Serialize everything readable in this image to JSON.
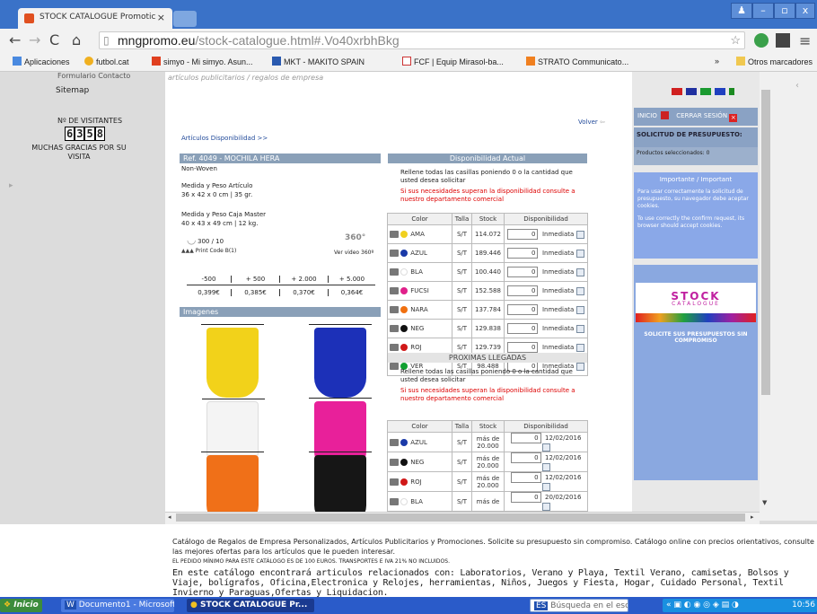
{
  "browser": {
    "tab_title": "STOCK CATALOGUE Promotic",
    "url_host": "mngpromo.eu",
    "url_path": "/stock-catalogue.html#.Vo40xrbhBkg"
  },
  "bookmarks": [
    "Aplicaciones",
    "futbol.cat",
    "simyo - Mi simyo. Asun...",
    "MKT - MAKITO SPAIN",
    "FCF | Equip Mirasol-ba...",
    "STRATO Communicato...",
    "»",
    "Otros marcadores"
  ],
  "left": {
    "contact": "Formulario Contacto",
    "sitemap": "Sitemap",
    "visitors_label": "Nº DE VISITANTES",
    "visitors": [
      "6",
      "3",
      "5",
      "8"
    ],
    "thanks": "MUCHAS GRACIAS POR SU VISITA"
  },
  "content": {
    "tagline": "artículos publicitarios / regalos de empresa",
    "breadcrumb": "Artículos Disponibilidad >>",
    "back": "Volver",
    "ref_bar": "Ref.   4049 - MOCHILA HERA",
    "material": "Non-Woven",
    "measure_label": "Medida y Peso Artículo",
    "measure": "36 x 42 x 0 cm  |  35 gr.",
    "box_label": "Medida y Peso Caja Master",
    "box": "40 x 43 x 49 cm  |  12 kg.",
    "pack": "300  / 10",
    "print": "Print Code B(1)",
    "video": "Ver video 360º",
    "rot": "360°",
    "price_headers": [
      "-500",
      "+ 500",
      "+ 2.000",
      "+ 5.000"
    ],
    "prices": [
      "0,399€",
      "0,385€",
      "0,370€",
      "0,364€"
    ],
    "images_bar": "Imagenes",
    "avail_bar": "Disponibilidad Actual",
    "note1": "Rellene todas las casillas poniendo 0 o la cantidad que usted desea solicitar",
    "note2": "Si sus necesidades superan la disponibilidad consulte a nuestro departamento comercial",
    "cols": [
      "Color",
      "Talla",
      "Stock",
      "Disponibilidad"
    ],
    "rows": [
      {
        "c": "AMA",
        "hex": "#f0d020",
        "t": "S/T",
        "s": "114.072",
        "q": "0",
        "d": "Inmediata"
      },
      {
        "c": "AZUL",
        "hex": "#1a3aa8",
        "t": "S/T",
        "s": "189.446",
        "q": "0",
        "d": "Inmediata"
      },
      {
        "c": "BLA",
        "hex": "#ffffff",
        "t": "S/T",
        "s": "100.440",
        "q": "0",
        "d": "Inmediata"
      },
      {
        "c": "FUCSI",
        "hex": "#e0208a",
        "t": "S/T",
        "s": "152.588",
        "q": "0",
        "d": "Inmediata"
      },
      {
        "c": "NARA",
        "hex": "#f07010",
        "t": "S/T",
        "s": "137.784",
        "q": "0",
        "d": "Inmediata"
      },
      {
        "c": "NEG",
        "hex": "#111111",
        "t": "S/T",
        "s": "129.838",
        "q": "0",
        "d": "Inmediata"
      },
      {
        "c": "ROJ",
        "hex": "#d01818",
        "t": "S/T",
        "s": "129.739",
        "q": "0",
        "d": "Inmediata"
      },
      {
        "c": "VER",
        "hex": "#10a030",
        "t": "S/T",
        "s": "98.488",
        "q": "0",
        "d": "Inmediata"
      }
    ],
    "next_bar": "PROXIMAS LLEGADAS",
    "note3": "Rellene todas las casillas poniendo 0 o la cantidad que usted desea solicitar",
    "note4": "Si sus necesidades superan la disponibilidad consulte a nuestro departamento comercial",
    "rows2": [
      {
        "c": "AZUL",
        "hex": "#1a3aa8",
        "t": "S/T",
        "s1": "más de",
        "s2": "20.000",
        "q": "0",
        "d": "12/02/2016"
      },
      {
        "c": "NEG",
        "hex": "#111111",
        "t": "S/T",
        "s1": "más de",
        "s2": "20.000",
        "q": "0",
        "d": "12/02/2016"
      },
      {
        "c": "ROJ",
        "hex": "#d01818",
        "t": "S/T",
        "s1": "más de",
        "s2": "20.000",
        "q": "0",
        "d": "12/02/2016"
      },
      {
        "c": "BLA",
        "hex": "#ffffff",
        "t": "S/T",
        "s1": "más de",
        "s2": "",
        "q": "0",
        "d": "20/02/2016"
      }
    ]
  },
  "right": {
    "inicio": "INICIO",
    "logout": "CERRAR SESIÓN",
    "presupuesto": "SOLICITUD DE PRESUPUESTO:",
    "productos": "Productos seleccionados: 0",
    "important": "Importante / Important",
    "es_note": "Para usar correctamente la solicitud de presupuesto, su navegador debe aceptar cookies.",
    "en_note": "To use correctly the confirm request, its browser should accept cookies.",
    "banner": "STOCK",
    "banner_sub": "CATALOGUE",
    "solicite": "SOLICITE SUS PRESUPUESTOS SIN COMPROMISO"
  },
  "footer": {
    "l1": "Catálogo de Regalos de Empresa Personalizados, Artículos Publicitarios y Promociones. Solicite su presupuesto sin compromiso. Catálogo online con precios orientativos, consulte las mejores ofertas para los artículos que le pueden interesar.",
    "l2": "EL PEDIDO MÍNIMO PARA ESTE CATÁLOGO ES DE 100 EUROS. TRANSPORTES E IVA 21% NO INCLUIDOS.",
    "l3": "En este catálogo encontrará articulos relacionados con: Laboratorios, Verano y Playa, Textil Verano, camisetas, Bolsos y Viaje, bolígrafos, Oficina,Electronica y Relojes, herramientas, Niños, Juegos y Fiesta, Hogar, Cuidado Personal, Textil Invierno y Paraguas,Ofertas y Liquidacion."
  },
  "taskbar": {
    "start": "Inicio",
    "word": "Documento1 - Microsoft ...",
    "chrome": "STOCK CATALOGUE Pr...",
    "search": "Búsqueda en el escrit",
    "time": "10:56"
  }
}
